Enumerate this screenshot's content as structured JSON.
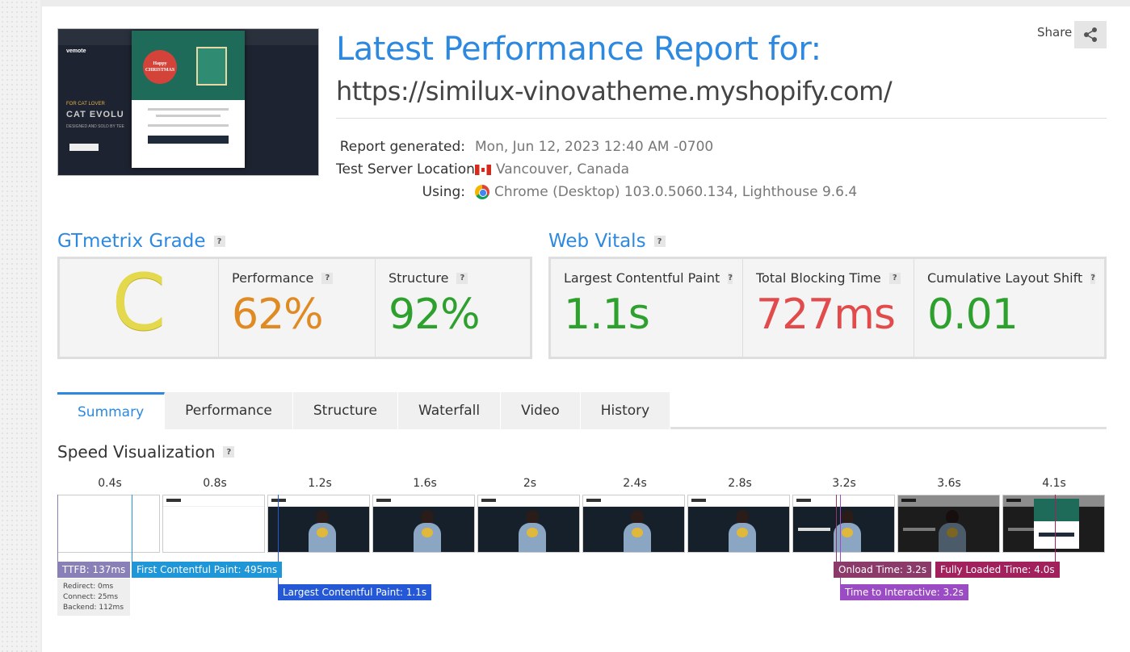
{
  "header": {
    "title": "Latest Performance Report for:",
    "url": "https://similux-vinovatheme.myshopify.com/",
    "share_label": "Share",
    "thumbnail": {
      "logo": "vemote",
      "hero_tag": "FOR CAT LOVER",
      "hero_title": "CAT EVOLU",
      "hero_sub": "DESIGNED AND SOLD BY TEE",
      "popup_text": "Happy CHRISTMAS"
    }
  },
  "meta": {
    "report_generated_label": "Report generated:",
    "report_generated_value": "Mon, Jun 12, 2023 12:40 AM -0700",
    "server_location_label": "Test Server Location:",
    "server_location_value": "Vancouver, Canada",
    "using_label": "Using:",
    "using_value": "Chrome (Desktop) 103.0.5060.134, Lighthouse 9.6.4"
  },
  "grade": {
    "heading": "GTmetrix Grade",
    "letter": "C",
    "performance_label": "Performance",
    "performance_value": "62%",
    "structure_label": "Structure",
    "structure_value": "92%"
  },
  "vitals": {
    "heading": "Web Vitals",
    "lcp_label": "Largest Contentful Paint",
    "lcp_value": "1.1s",
    "tbt_label": "Total Blocking Time",
    "tbt_value": "727ms",
    "cls_label": "Cumulative Layout Shift",
    "cls_value": "0.01"
  },
  "colors": {
    "accent": "#2d89e0",
    "grade_c": "#e4d84c",
    "performance": "#e08a23",
    "good": "#2ea02e",
    "bad": "#e24b4b"
  },
  "tabs": [
    {
      "label": "Summary",
      "active": true
    },
    {
      "label": "Performance",
      "active": false
    },
    {
      "label": "Structure",
      "active": false
    },
    {
      "label": "Waterfall",
      "active": false
    },
    {
      "label": "Video",
      "active": false
    },
    {
      "label": "History",
      "active": false
    }
  ],
  "speed": {
    "heading": "Speed Visualization",
    "ticks": [
      "0.4s",
      "0.8s",
      "1.2s",
      "1.6s",
      "2s",
      "2.4s",
      "2.8s",
      "3.2s",
      "3.6s",
      "4.1s"
    ],
    "markers": {
      "ttfb": "TTFB: 137ms",
      "fcp": "First Contentful Paint: 495ms",
      "lcp": "Largest Contentful Paint: 1.1s",
      "onload": "Onload Time: 3.2s",
      "fully_loaded": "Fully Loaded Time: 4.0s",
      "tti": "Time to Interactive: 3.2s"
    },
    "ttfb_detail": {
      "redirect": "Redirect: 0ms",
      "connect": "Connect: 25ms",
      "backend": "Backend: 112ms"
    }
  },
  "icons": {
    "share": "share-icon",
    "help": "question-icon",
    "flag": "canada-flag-icon",
    "browser": "chrome-icon"
  },
  "help_glyph": "?"
}
